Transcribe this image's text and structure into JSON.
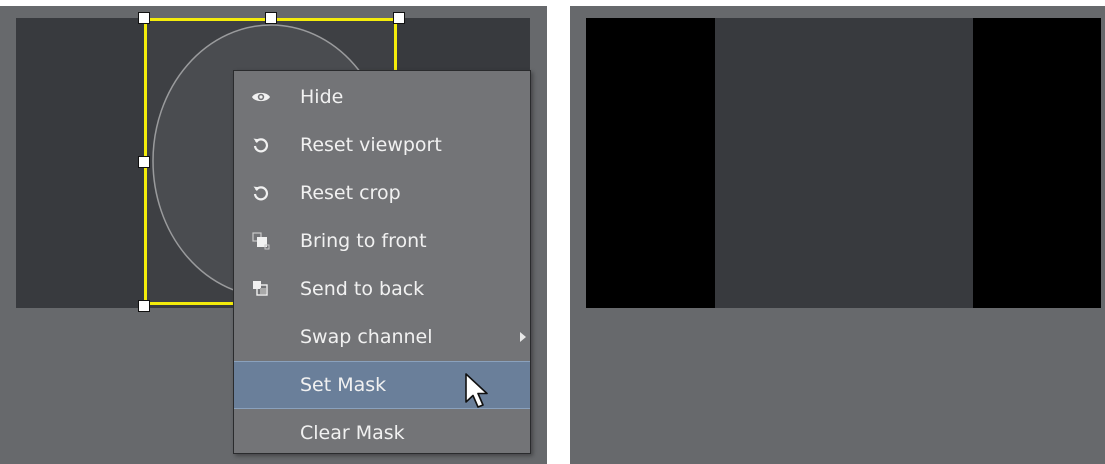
{
  "context_menu": {
    "items": [
      {
        "label": "Hide",
        "icon": "eye-icon"
      },
      {
        "label": "Reset viewport",
        "icon": "undo-icon"
      },
      {
        "label": "Reset crop",
        "icon": "undo-icon"
      },
      {
        "label": "Bring to front",
        "icon": "bring-to-front-icon"
      },
      {
        "label": "Send to back",
        "icon": "send-to-back-icon"
      },
      {
        "label": "Swap channel",
        "icon": "",
        "has_submenu": true
      },
      {
        "label": "Set Mask",
        "icon": "",
        "highlighted": true
      },
      {
        "label": "Clear Mask",
        "icon": ""
      }
    ]
  },
  "colors": {
    "selection": "#f4ec0b",
    "highlight": "#6a7f9a",
    "panel": "#67696c",
    "canvas": "#383a3e"
  }
}
